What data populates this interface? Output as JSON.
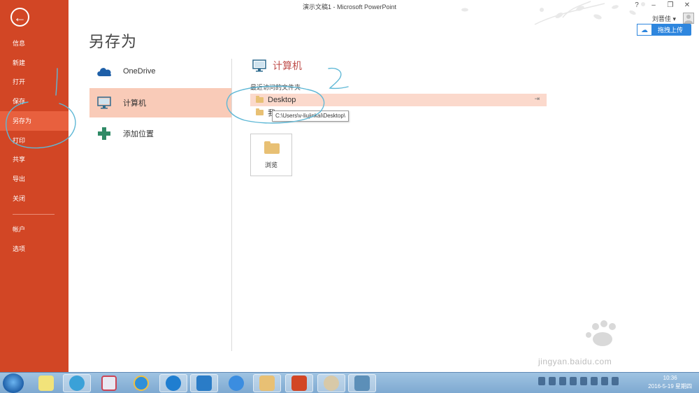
{
  "window": {
    "title": "演示文稿1 - Microsoft PowerPoint",
    "controls": [
      "?",
      "–",
      "❐",
      "✕"
    ],
    "user_name": "刘晋佳 ▾",
    "upload_label": "拖拽上传"
  },
  "sidebar": {
    "back_glyph": "←",
    "items": [
      {
        "label": "信息"
      },
      {
        "label": "新建"
      },
      {
        "label": "打开"
      },
      {
        "label": "保存"
      },
      {
        "label": "另存为"
      },
      {
        "label": "打印"
      },
      {
        "label": "共享"
      },
      {
        "label": "导出"
      },
      {
        "label": "关闭"
      },
      {
        "label": "帐户"
      },
      {
        "label": "选项"
      }
    ],
    "active_index": 4,
    "accent_color": "#d24625"
  },
  "page": {
    "title": "另存为"
  },
  "locations": [
    {
      "label": "OneDrive",
      "icon": "onedrive-cloud-icon"
    },
    {
      "label": "计算机",
      "icon": "computer-monitor-icon"
    },
    {
      "label": "添加位置",
      "icon": "plus-icon"
    }
  ],
  "panel": {
    "title": "计算机",
    "recent_label": "最近访问的文件夹",
    "recent_folders": [
      {
        "label": "Desktop"
      },
      {
        "label": "我"
      }
    ],
    "tooltip": "C:\\Users\\v-liujinkai\\Desktop\\",
    "browse_label": "浏览"
  },
  "watermark": {
    "text": "jingyan.baidu.com"
  },
  "taskbar": {
    "time": "10:36",
    "date": "2016-5-19 星期四"
  }
}
